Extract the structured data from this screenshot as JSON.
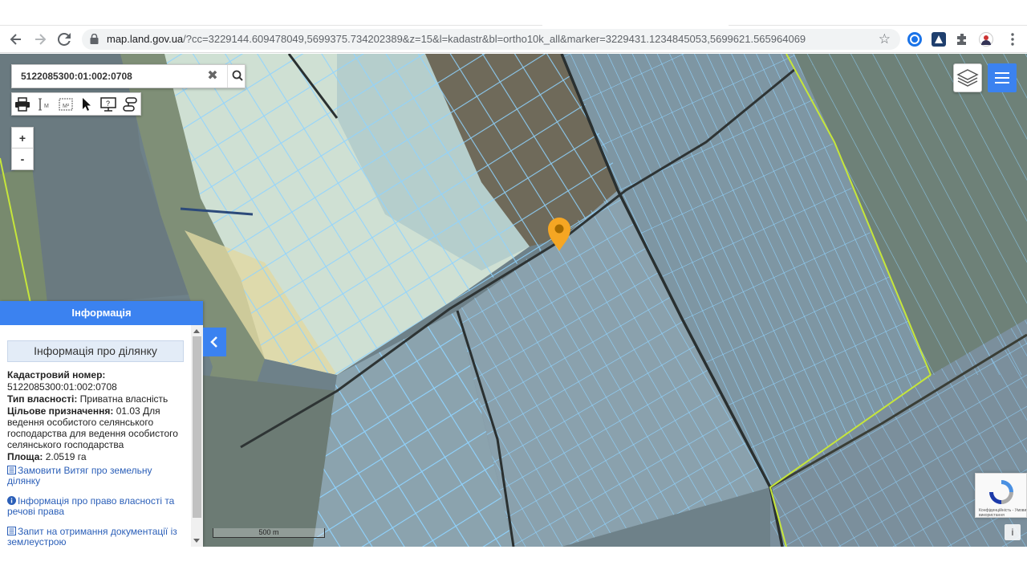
{
  "browser": {
    "url_host": "map.land.gov.ua",
    "url_path": "/?cc=3229144.609478049,5699375.734202389&z=15&l=kadastr&bl=ortho10k_all&marker=3229431.1234845053,5699621.565964069"
  },
  "search": {
    "value": "5122085300:01:002:0708",
    "clear_glyph": "✖"
  },
  "zoom": {
    "in": "+",
    "out": "-"
  },
  "panel": {
    "header": "Інформація",
    "section_title": "Інформація про ділянку",
    "cadastral_label": "Кадастровий номер:",
    "cadastral_value": "5122085300:01:002:0708",
    "ownership_label": "Тип власності:",
    "ownership_value": "Приватна власність",
    "purpose_label": "Цільове призначення:",
    "purpose_value": "01.03 Для ведення особистого селянського господарства для ведення особистого селянського господарства",
    "area_label": "Площа:",
    "area_value": "2.0519 га",
    "links": [
      "Замовити Витяг про земельну ділянку",
      "Інформація про право власності та речові права",
      "Запит на отримання документації із землеустрою"
    ]
  },
  "scale": {
    "label": "500 m"
  },
  "recaptcha": {
    "text": "Конфіденційність - Умови використання"
  },
  "info_button": "i",
  "colors": {
    "accent": "#3b82f0",
    "marker": "#f5a623",
    "parcel_stroke": "#8fd3ff",
    "boundary": "#c6e63a"
  }
}
